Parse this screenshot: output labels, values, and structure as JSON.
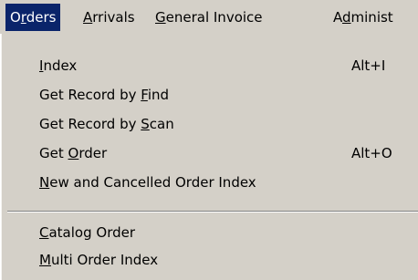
{
  "menubar": {
    "items": [
      {
        "pre": "O",
        "key": "r",
        "post": "ders",
        "active": true
      },
      {
        "pre": "",
        "key": "A",
        "post": "rrivals",
        "active": false
      },
      {
        "pre": "",
        "key": "G",
        "post": "eneral Invoice",
        "active": false
      },
      {
        "pre": "A",
        "key": "d",
        "post": "minist",
        "active": false
      }
    ]
  },
  "dropdown": {
    "items": [
      {
        "pre": "",
        "key": "I",
        "post": "ndex",
        "shortcut": "Alt+I"
      },
      {
        "pre": "Get Record by ",
        "key": "F",
        "post": "ind",
        "shortcut": ""
      },
      {
        "pre": "Get Record by ",
        "key": "S",
        "post": "can",
        "shortcut": ""
      },
      {
        "pre": "Get ",
        "key": "O",
        "post": "rder",
        "shortcut": "Alt+O"
      },
      {
        "pre": "",
        "key": "N",
        "post": "ew and Cancelled Order Index",
        "shortcut": ""
      },
      {
        "pre": "",
        "key": "C",
        "post": "atalog Order",
        "shortcut": ""
      },
      {
        "pre": "",
        "key": "M",
        "post": "ulti Order Index",
        "shortcut": ""
      }
    ]
  },
  "colors": {
    "menu_bg": "#d4d0c8",
    "highlight": "#0a246a",
    "highlight_text": "#ffffff"
  }
}
